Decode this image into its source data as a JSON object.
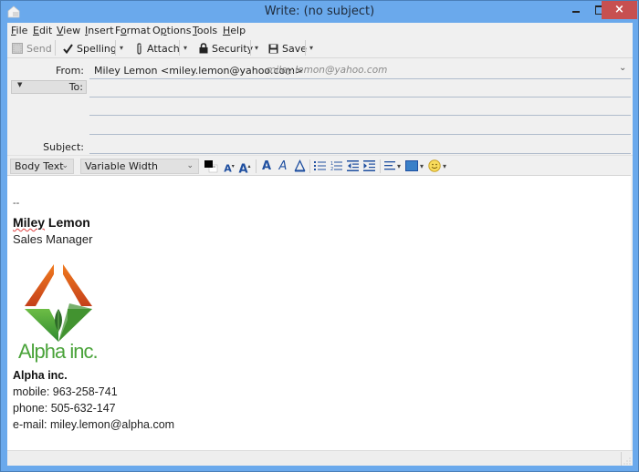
{
  "window": {
    "title": "Write: (no subject)",
    "controls": {
      "minimize": "minimize",
      "maximize": "maximize",
      "close": "×"
    }
  },
  "menu": [
    {
      "label": "File",
      "mnemonic": "F",
      "rest": "ile"
    },
    {
      "label": "Edit",
      "mnemonic": "E",
      "rest": "dit"
    },
    {
      "label": "View",
      "mnemonic": "V",
      "rest": "iew"
    },
    {
      "label": "Insert",
      "mnemonic": "I",
      "rest": "nsert"
    },
    {
      "label": "Format",
      "prefix": "F",
      "mnemonic": "o",
      "rest": "rmat"
    },
    {
      "label": "Options",
      "prefix": "O",
      "mnemonic": "p",
      "rest": "tions"
    },
    {
      "label": "Tools",
      "mnemonic": "T",
      "rest": "ools"
    },
    {
      "label": "Help",
      "mnemonic": "H",
      "rest": "elp"
    }
  ],
  "toolbar": {
    "send": {
      "label": "Send",
      "icon": "send-icon",
      "disabled": true
    },
    "spelling": {
      "label": "Spelling",
      "icon": "checkmark-icon"
    },
    "attach": {
      "label": "Attach",
      "icon": "paperclip-icon"
    },
    "security": {
      "label": "Security",
      "icon": "lock-icon"
    },
    "save": {
      "label": "Save",
      "icon": "floppy-disk-icon"
    },
    "dropdown_glyph": "▾"
  },
  "header": {
    "from_label": "From:",
    "from_value": "Miley Lemon <miley.lemon@yahoo.com>",
    "from_identity": "miley.lemon@yahoo.com",
    "to_label": "To:",
    "to_value": "",
    "subject_label": "Subject:",
    "subject_value": ""
  },
  "format_toolbar": {
    "paragraph_style": "Body Text",
    "font": "Variable Width",
    "chevron": "⌄",
    "icons": {
      "text_color": "text-color-icon",
      "smaller": "A",
      "larger": "A",
      "bold": "A",
      "italic": "A",
      "underline": "A"
    }
  },
  "signature": {
    "separator": "--",
    "name": "Miley Lemon",
    "name_first": "Miley",
    "name_last": " Lemon",
    "title": "Sales Manager",
    "logo_text": "Alpha inc.",
    "company": "Alpha inc.",
    "mobile": "mobile: 963-258-741",
    "phone": "phone: 505-632-147",
    "email": "e-mail: miley.lemon@alpha.com"
  },
  "colors": {
    "titlebar": "#6aa9ec",
    "close_button": "#c75050",
    "logo_orange": "#e2661a",
    "logo_green": "#4aa33a",
    "format_icon_blue": "#1f4fa0"
  }
}
